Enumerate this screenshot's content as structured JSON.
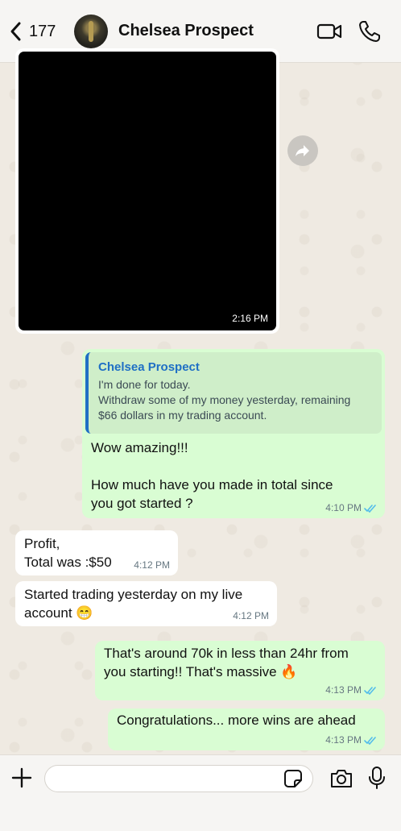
{
  "header": {
    "back_count": "177",
    "contact_name": "Chelsea Prospect"
  },
  "messages": {
    "media": {
      "time": "2:16 PM"
    },
    "quoted_reply": {
      "quote_name": "Chelsea Prospect",
      "quote_text": "I'm done for today.\nWithdraw some of my money yesterday, remaining\n$66 dollars in my trading account.",
      "text": "Wow amazing!!!\n\nHow much have you made in total since\nyou got started ?",
      "time": "4:10 PM"
    },
    "in1": {
      "text": "Profit,\nTotal was :$50",
      "time": "4:12 PM"
    },
    "in2": {
      "text": "Started trading yesterday on my live\naccount 😁",
      "time": "4:12 PM"
    },
    "out2": {
      "text": "That's around 70k in less than 24hr from\nyou starting!! That's massive 🔥",
      "time": "4:13 PM"
    },
    "out3": {
      "text": "Congratulations... more wins are ahead",
      "time": "4:13 PM"
    }
  },
  "input": {
    "value": "",
    "placeholder": ""
  },
  "colors": {
    "outgoing_bubble": "#d9fdd3",
    "incoming_bubble": "#ffffff",
    "read_ticks": "#53bdeb",
    "quote_accent": "#1f6fc5"
  },
  "icons": [
    "chevron-left-icon",
    "video-icon",
    "phone-icon",
    "forward-icon",
    "double-check-icon",
    "plus-icon",
    "sticker-icon",
    "camera-icon",
    "microphone-icon"
  ]
}
